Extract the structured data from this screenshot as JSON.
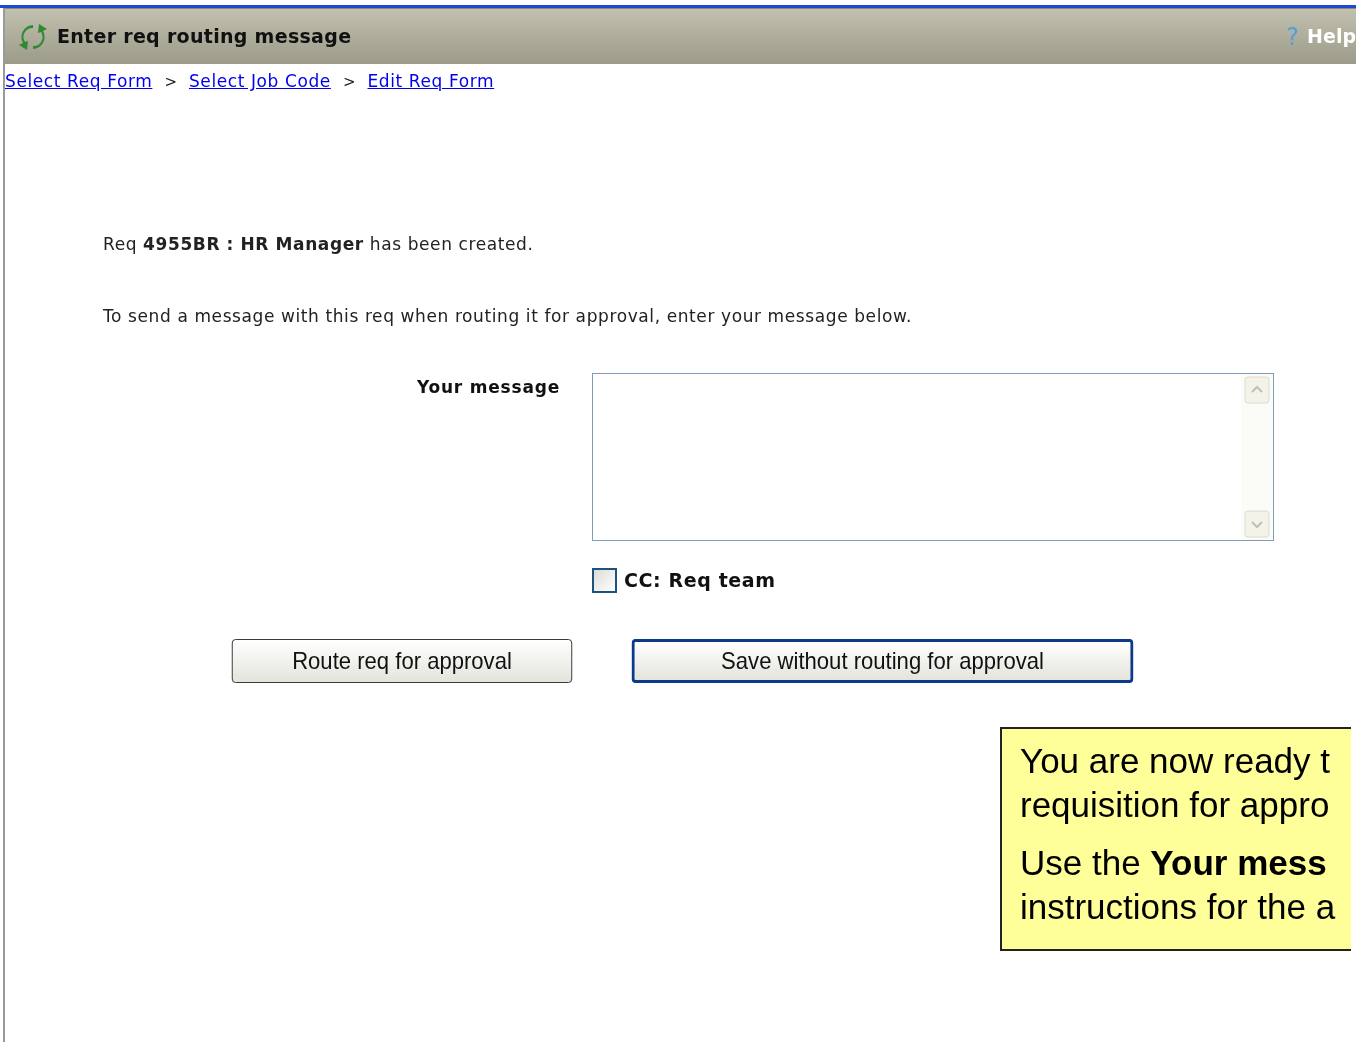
{
  "header": {
    "title": "Enter req routing message",
    "help": "Help",
    "help_icon": "?"
  },
  "breadcrumbs": [
    "Select Req Form",
    "Select Job Code",
    "Edit Req Form"
  ],
  "breadcrumb_separator": ">",
  "status_text": "Req **4955BR : HR Manager** has been created.",
  "instruction": "To send a message with this req when routing it for approval, enter your message below.",
  "message_field": {
    "label": "Your message"
  },
  "cc_checkbox": {
    "label": "CC: Req team",
    "checked": false
  },
  "buttons": [
    {
      "label": "Route req for approval",
      "default": false
    },
    {
      "label": "Save without routing for approval",
      "default": true
    }
  ],
  "callout": {
    "paragraphs": [
      [
        "You are now ready t",
        "requisition for appro"
      ],
      [
        "Use the **Your mess**",
        "instructions for the a"
      ]
    ]
  }
}
